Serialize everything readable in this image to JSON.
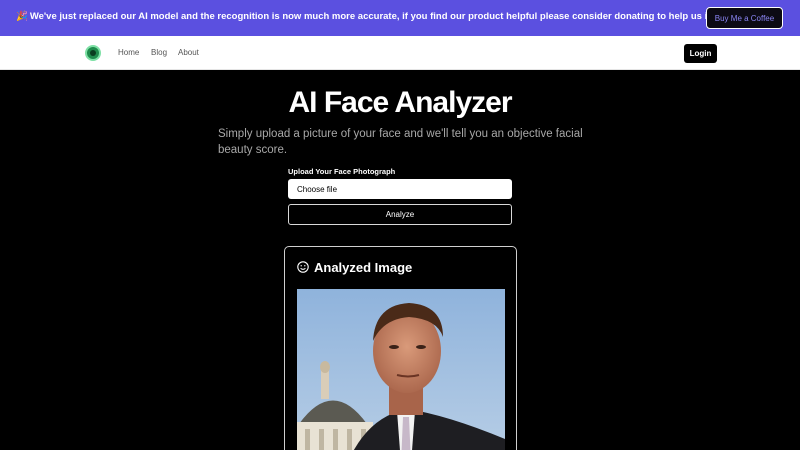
{
  "banner": {
    "emoji_left": "🎉",
    "text": "We've just replaced our AI model and the recognition is now much more accurate, if you find our product helpful please consider donating to help us improve it!",
    "emoji_right": "💖",
    "donate_button": "Buy Me a Coffee"
  },
  "nav": {
    "logo_icon": "face-logo-icon",
    "links": [
      "Home",
      "Blog",
      "About"
    ],
    "login_button": "Login"
  },
  "main": {
    "title": "AI Face Analyzer",
    "subtitle": "Simply upload a picture of your face and we'll tell you an objective facial beauty score.",
    "upload_label": "Upload Your Face Photograph",
    "file_input_label": "Choose file",
    "analyze_button": "Analyze"
  },
  "result": {
    "icon": "smiley-icon",
    "title": "Analyzed Image"
  },
  "colors": {
    "banner_bg": "#5b50e0",
    "page_bg": "#000000",
    "navbar_bg": "#ffffff"
  }
}
